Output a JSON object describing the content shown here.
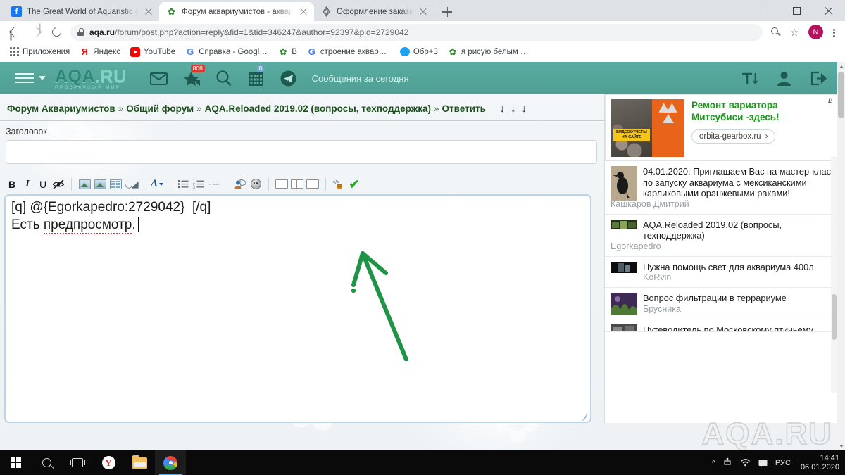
{
  "browser": {
    "tabs": [
      {
        "title": "The Great World of Aquaristic &...",
        "icon": "facebook-icon",
        "active": false
      },
      {
        "title": "Форум аквариумистов - аквари...",
        "icon": "leaf-icon",
        "active": true
      },
      {
        "title": "Оформление заказа",
        "icon": "diamond-icon",
        "active": false
      }
    ],
    "new_tab_label": "+",
    "window_controls": {
      "minimize": "minimize-icon",
      "maximize": "maximize-icon",
      "close": "close-icon"
    },
    "nav": {
      "back": "back-arrow-icon",
      "forward": "forward-arrow-icon",
      "reload": "reload-icon"
    },
    "omnibox": {
      "lock": "lock-icon",
      "url_host": "aqa.ru",
      "url_path": "/forum/post.php?action=reply&fid=1&tid=346247&author=92397&pid=2729042"
    },
    "toolbar_right": {
      "zoom": "zoom-search-icon",
      "bookmark": "star-icon",
      "profile_initial": "N",
      "menu": "kebab-menu-icon"
    },
    "bookmarks": [
      {
        "label": "Приложения",
        "icon": "apps-grid-icon"
      },
      {
        "label": "Яндекс",
        "icon": "yandex-icon"
      },
      {
        "label": "YouTube",
        "icon": "youtube-icon"
      },
      {
        "label": "Справка - Google...",
        "icon": "google-icon"
      },
      {
        "label": "В",
        "icon": "leaf-icon"
      },
      {
        "label": "строение аквариу...",
        "icon": "google-icon"
      },
      {
        "label": "Обр+3",
        "icon": "blue-circle-icon"
      },
      {
        "label": "я рисую белым ме...",
        "icon": "leaf-icon"
      }
    ]
  },
  "site_header": {
    "menu_icon": "hamburger-icon",
    "caret_icon": "chevron-down-icon",
    "logo_main": "AQA",
    "logo_dot": ".RU",
    "logo_tagline": "ПРОЗРАЧНЫЙ МИР",
    "icons": [
      {
        "name": "mail-icon",
        "badge": ""
      },
      {
        "name": "bookmark-star-icon",
        "badge": "808"
      },
      {
        "name": "search-icon",
        "badge": ""
      },
      {
        "name": "calendar-icon",
        "badge": "0"
      },
      {
        "name": "telegram-icon",
        "badge": ""
      }
    ],
    "note": "Сообщения за сегодня",
    "right_icons": [
      "font-size-icon",
      "user-profile-icon",
      "logout-icon"
    ]
  },
  "breadcrumb": {
    "items": [
      "Форум Аквариумистов",
      "Общий форум",
      "AQA.Reloaded 2019.02 (вопросы, техподдержка)",
      "Ответить"
    ],
    "separator": "»",
    "jump_arrows": [
      "↓",
      "↓",
      "↓"
    ]
  },
  "form": {
    "title_label": "Заголовок",
    "title_value": "",
    "title_placeholder": ""
  },
  "editor_toolbar": {
    "groups": [
      [
        {
          "name": "bold-button",
          "label": "B"
        },
        {
          "name": "italic-button",
          "label": "I"
        },
        {
          "name": "underline-button",
          "label": "U"
        },
        {
          "name": "strike-eye-button",
          "label": ""
        }
      ],
      [
        {
          "name": "insert-image-button",
          "label": ""
        },
        {
          "name": "insert-attachment-button",
          "label": ""
        },
        {
          "name": "insert-gallery-button",
          "label": ""
        },
        {
          "name": "insert-link-button",
          "label": ""
        }
      ],
      [
        {
          "name": "font-color-button",
          "label": "A"
        }
      ],
      [
        {
          "name": "bullet-list-button",
          "label": ""
        },
        {
          "name": "numbered-list-button",
          "label": ""
        },
        {
          "name": "horizontal-rule-button",
          "label": ""
        }
      ],
      [
        {
          "name": "mention-user-button",
          "label": ""
        },
        {
          "name": "emoji-button",
          "label": ""
        }
      ],
      [
        {
          "name": "layout-single-button",
          "label": ""
        },
        {
          "name": "layout-two-column-button",
          "label": ""
        },
        {
          "name": "layout-split-button",
          "label": ""
        }
      ],
      [
        {
          "name": "source-code-button",
          "label": ""
        },
        {
          "name": "preview-confirm-button",
          "label": "✔"
        }
      ]
    ]
  },
  "post_body": {
    "line1": "[q] @{Egorkapedro:2729042}  [/q]",
    "line2_prefix": "Есть ",
    "line2_typo": "предпросмотр",
    "line2_suffix": "."
  },
  "annotation": {
    "type": "green-arrow",
    "points_to": "preview-confirm-button",
    "color": "#1f9446"
  },
  "sidebar": {
    "ad": {
      "marker": "₽",
      "close": "×",
      "title_line1": "Ремонт вариатора",
      "title_line2": "Митсубиси -здесь!",
      "url": "orbita-gearbox.ru",
      "url_arrow": "›",
      "image_badge_line1": "ВИДЕООТЧЕТЫ",
      "image_badge_line2": "НА САЙТЕ"
    },
    "topics": [
      {
        "title": "04.01.2020: Приглашаем Вас на мастер-класс по запуску аквариума с мексиканскими карликовыми оранжевыми раками!",
        "author": "Кашкаров Дмитрий",
        "thumb": "bird-thumb"
      },
      {
        "title": "AQA.Reloaded 2019.02 (вопросы, техподдержка)",
        "author": "Egorkapedro",
        "thumb": "aquarium-thumb"
      },
      {
        "title": "Нужна помощь свет для аквариума 400л",
        "author": "KoRvin",
        "thumb": "dark-thumb"
      },
      {
        "title": "Вопрос фильтрации в террариуме",
        "author": "Брусника",
        "thumb": "plant-thumb"
      },
      {
        "title": "Путеводитель по Московскому птичьему...",
        "author": "",
        "thumb": "grey-thumb"
      }
    ]
  },
  "watermark": "AQA.RU",
  "taskbar": {
    "items": [
      {
        "name": "start-button",
        "icon": "windows-logo-icon",
        "active": false
      },
      {
        "name": "search-taskbar-button",
        "icon": "search-icon",
        "active": false
      },
      {
        "name": "task-view-button",
        "icon": "task-view-icon",
        "active": false
      },
      {
        "name": "yandex-browser-button",
        "icon": "yandex-icon",
        "active": false
      },
      {
        "name": "file-explorer-button",
        "icon": "folder-icon",
        "active": false
      },
      {
        "name": "chrome-button",
        "icon": "chrome-icon",
        "active": true
      }
    ],
    "tray": {
      "chevron": "^",
      "icons": [
        "usb-icon",
        "wifi-icon",
        "notification-icon"
      ],
      "language": "РУС",
      "time": "14:41",
      "date": "06.01.2020"
    }
  }
}
